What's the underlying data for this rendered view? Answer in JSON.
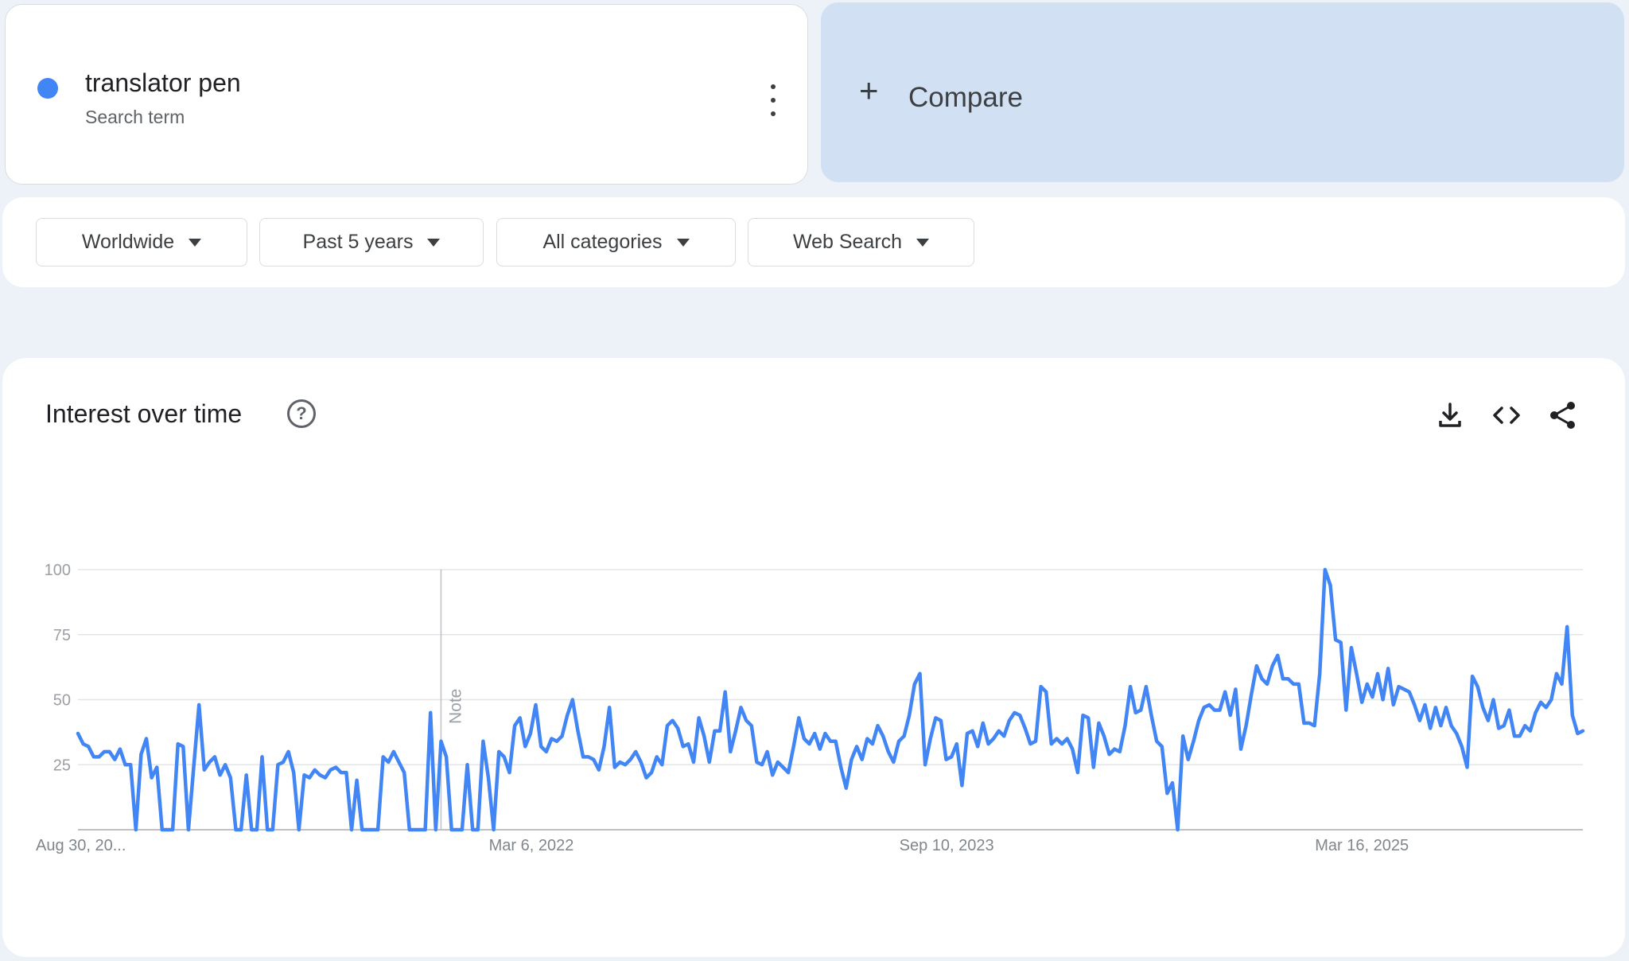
{
  "term": {
    "name": "translator pen",
    "sub": "Search term",
    "color": "#4285f4"
  },
  "compare": {
    "label": "Compare"
  },
  "filters": [
    {
      "label": "Worldwide"
    },
    {
      "label": "Past 5 years"
    },
    {
      "label": "All categories"
    },
    {
      "label": "Web Search"
    }
  ],
  "chart": {
    "title": "Interest over time",
    "icons": [
      "download-icon",
      "embed-code-icon",
      "share-icon"
    ]
  },
  "chart_data": {
    "type": "line",
    "title": "Interest over time",
    "xlabel": "",
    "ylabel": "",
    "ylim": [
      0,
      100
    ],
    "yticks": [
      25,
      50,
      75,
      100
    ],
    "grid": true,
    "legend": "none",
    "x_tick_labels": [
      {
        "label": "Aug 30, 20...",
        "index": 0
      },
      {
        "label": "Mar 6, 2022",
        "index": 79
      },
      {
        "label": "Sep 10, 2023",
        "index": 157
      },
      {
        "label": "Mar 16, 2025",
        "index": 236
      }
    ],
    "annotation": {
      "label": "Note",
      "index": 69
    },
    "series": [
      {
        "color": "#4285f4",
        "values": [
          37,
          33,
          32,
          28,
          28,
          30,
          30,
          27,
          31,
          25,
          25,
          0,
          29,
          35,
          20,
          24,
          0,
          0,
          0,
          33,
          32,
          0,
          24,
          48,
          23,
          26,
          28,
          21,
          25,
          20,
          0,
          0,
          21,
          0,
          0,
          28,
          0,
          0,
          25,
          26,
          30,
          22,
          0,
          21,
          20,
          23,
          21,
          20,
          23,
          24,
          22,
          22,
          0,
          19,
          0,
          0,
          0,
          0,
          28,
          26,
          30,
          26,
          22,
          0,
          0,
          0,
          0,
          45,
          0,
          34,
          28,
          0,
          0,
          0,
          25,
          0,
          0,
          34,
          20,
          0,
          30,
          28,
          22,
          40,
          43,
          32,
          37,
          48,
          32,
          30,
          35,
          34,
          36,
          44,
          50,
          38,
          28,
          28,
          27,
          23,
          32,
          47,
          24,
          26,
          25,
          27,
          30,
          26,
          20,
          22,
          28,
          25,
          40,
          42,
          39,
          32,
          33,
          26,
          43,
          36,
          26,
          38,
          38,
          53,
          30,
          38,
          47,
          42,
          40,
          26,
          25,
          30,
          21,
          26,
          24,
          22,
          32,
          43,
          35,
          33,
          37,
          31,
          37,
          34,
          34,
          24,
          16,
          27,
          32,
          27,
          35,
          33,
          40,
          36,
          30,
          26,
          34,
          36,
          44,
          56,
          60,
          25,
          35,
          43,
          42,
          27,
          28,
          33,
          17,
          37,
          38,
          32,
          41,
          33,
          35,
          38,
          36,
          42,
          45,
          44,
          39,
          33,
          34,
          55,
          53,
          33,
          35,
          33,
          35,
          31,
          22,
          44,
          43,
          24,
          41,
          36,
          29,
          31,
          30,
          40,
          55,
          45,
          46,
          55,
          44,
          34,
          32,
          14,
          18,
          0,
          36,
          27,
          34,
          42,
          47,
          48,
          46,
          46,
          53,
          44,
          54,
          31,
          40,
          52,
          63,
          58,
          56,
          63,
          67,
          58,
          58,
          56,
          56,
          41,
          41,
          40,
          60,
          100,
          94,
          73,
          72,
          46,
          70,
          60,
          49,
          56,
          51,
          60,
          50,
          62,
          48,
          55,
          54,
          53,
          48,
          42,
          48,
          39,
          47,
          40,
          47,
          40,
          37,
          32,
          24,
          59,
          55,
          47,
          42,
          50,
          39,
          40,
          46,
          36,
          36,
          40,
          38,
          45,
          49,
          47,
          50,
          60,
          56,
          78,
          44,
          37,
          38
        ]
      }
    ]
  }
}
